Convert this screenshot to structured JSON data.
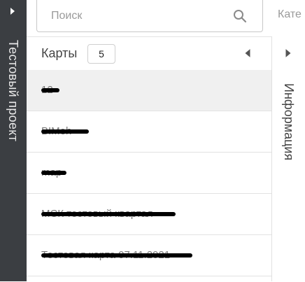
{
  "project": {
    "title": "Тестовый проект"
  },
  "search": {
    "placeholder": "Поиск",
    "value": ""
  },
  "category": {
    "label": "Кате"
  },
  "cards_panel": {
    "title": "Карты",
    "count": "5",
    "items": [
      {
        "label": "12",
        "selected": true
      },
      {
        "label": "BIMeh"
      },
      {
        "label": "map"
      },
      {
        "label": "МСК тестовый квартал"
      },
      {
        "label": "Тестовая карта 07.11.2021"
      }
    ]
  },
  "info_panel": {
    "title": "Информация"
  },
  "icons": {
    "expand_left_rail": "triangle-right-icon",
    "search": "search-icon",
    "collapse_cards": "triangle-left-icon",
    "expand_info": "triangle-right-icon"
  },
  "colors": {
    "rail_bg": "#3b3e42",
    "selected_row": "#f0f0f0",
    "text_muted": "#9a9a9a"
  }
}
